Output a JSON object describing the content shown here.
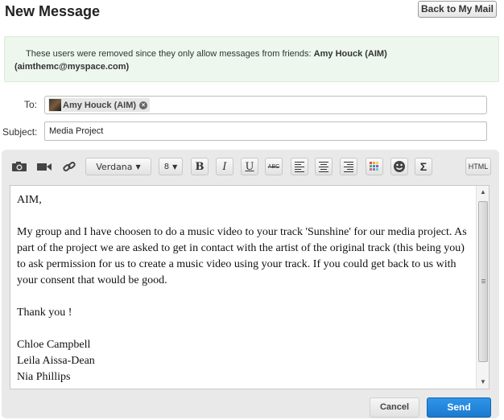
{
  "header": {
    "title": "New Message",
    "back_button": "Back to My Mail"
  },
  "notice": {
    "text": "These users were removed since they only allow messages from friends:",
    "names_line1": "Amy Houck (AIM)",
    "names_line2": "(aimthemc@myspace.com)"
  },
  "to": {
    "label": "To:",
    "recipient": "Amy Houck (AIM)",
    "remove_glyph": "×"
  },
  "subject": {
    "label": "Subject:",
    "value": "Media Project"
  },
  "toolbar": {
    "font": "Verdana",
    "size": "8",
    "bold": "B",
    "italic": "I",
    "underline": "U",
    "strike": "ABC",
    "sigma": "Σ",
    "html": "HTML",
    "icons": [
      "camera-icon",
      "video-icon",
      "link-icon",
      "align-left-icon",
      "align-center-icon",
      "align-right-icon",
      "color-palette-icon",
      "emoticon-icon",
      "symbol-icon"
    ]
  },
  "body": {
    "lines": [
      "AIM,",
      "",
      "My group and I have choosen to do a music video to your track 'Sunshine' for our media project. As part of the project we are asked to get in contact with the artist of the original track (this being you) to ask permission for us to create a music video using your track. If you could get back to us with your consent that would be good.",
      "",
      "Thank you !",
      "",
      "Chloe Campbell",
      "Leila Aissa-Dean",
      "Nia Phillips"
    ]
  },
  "actions": {
    "cancel": "Cancel",
    "send": "Send"
  },
  "colors": {
    "send": "#1f84d8",
    "notice_bg": "#eef7ee",
    "panel": "#e9e9e9"
  }
}
